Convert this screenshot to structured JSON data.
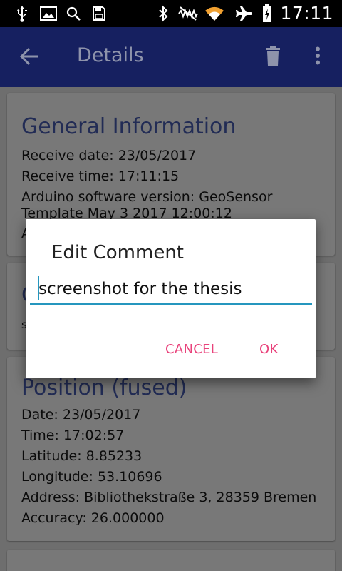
{
  "status_bar": {
    "time": "17:11",
    "icons": [
      "usb-icon",
      "image-icon",
      "search-icon",
      "save-icon",
      "bluetooth-icon",
      "vibrate-icon",
      "wifi-icon",
      "airplane-icon",
      "battery-icon"
    ]
  },
  "app_bar": {
    "title": "Details",
    "icons": [
      "back-arrow-icon",
      "delete-icon",
      "more-vert-icon"
    ]
  },
  "general": {
    "title": "General Information",
    "receive_date": "Receive date: 23/05/2017",
    "receive_time": "Receive time: 17:11:15",
    "software_line1": "Arduino software version: GeoSensor",
    "software_line2": "Template May  3 2017 12:00:12",
    "partial": "A"
  },
  "comment_card": {
    "title_partial": "C",
    "text_partial": "s"
  },
  "position": {
    "title": "Position (fused)",
    "date": "Date: 23/05/2017",
    "time": "Time: 17:02:57",
    "latitude": "Latitude: 8.85233",
    "longitude": "Longitude: 53.10696",
    "address": "Address: Bibliothekstraße 3, 28359 Bremen",
    "accuracy": "Accuracy: 26.000000"
  },
  "dialog": {
    "title": "Edit Comment",
    "input_value": "screenshot for the thesis",
    "cancel_label": "CANCEL",
    "ok_label": "OK"
  },
  "colors": {
    "accent": "#e9427b",
    "input_underline": "#2596be",
    "app_bar": "#162060"
  }
}
